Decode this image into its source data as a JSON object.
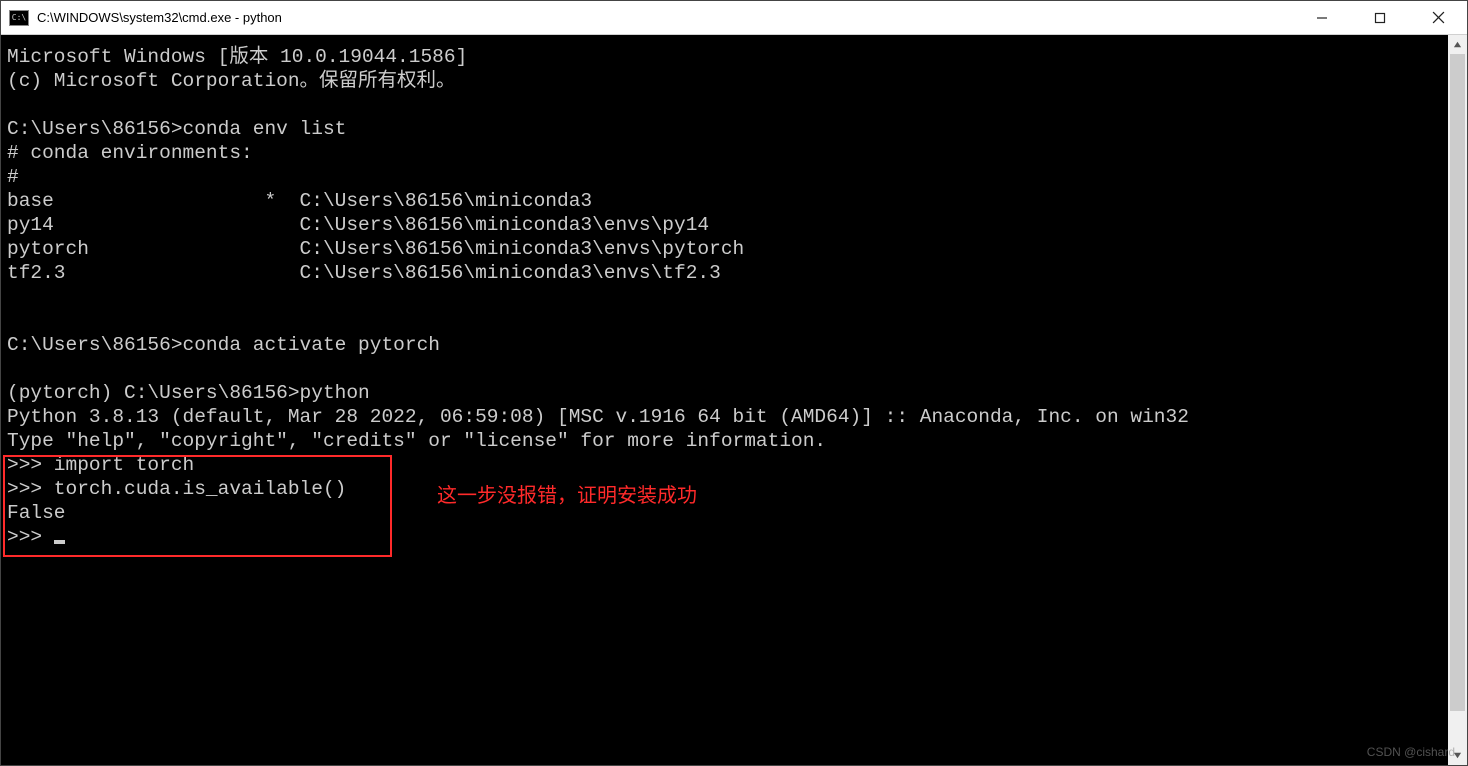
{
  "window": {
    "title": "C:\\WINDOWS\\system32\\cmd.exe - python"
  },
  "terminal": {
    "lines": [
      "Microsoft Windows [版本 10.0.19044.1586]",
      "(c) Microsoft Corporation。保留所有权利。",
      "",
      "C:\\Users\\86156>conda env list",
      "# conda environments:",
      "#",
      "base                  *  C:\\Users\\86156\\miniconda3",
      "py14                     C:\\Users\\86156\\miniconda3\\envs\\py14",
      "pytorch                  C:\\Users\\86156\\miniconda3\\envs\\pytorch",
      "tf2.3                    C:\\Users\\86156\\miniconda3\\envs\\tf2.3",
      "",
      "",
      "C:\\Users\\86156>conda activate pytorch",
      "",
      "(pytorch) C:\\Users\\86156>python",
      "Python 3.8.13 (default, Mar 28 2022, 06:59:08) [MSC v.1916 64 bit (AMD64)] :: Anaconda, Inc. on win32",
      "Type \"help\", \"copyright\", \"credits\" or \"license\" for more information.",
      ">>> import torch",
      ">>> torch.cuda.is_available()",
      "False",
      ">>> "
    ]
  },
  "annotation": {
    "text": "这一步没报错，证明安装成功"
  },
  "watermark": {
    "text": "CSDN @cishard"
  }
}
